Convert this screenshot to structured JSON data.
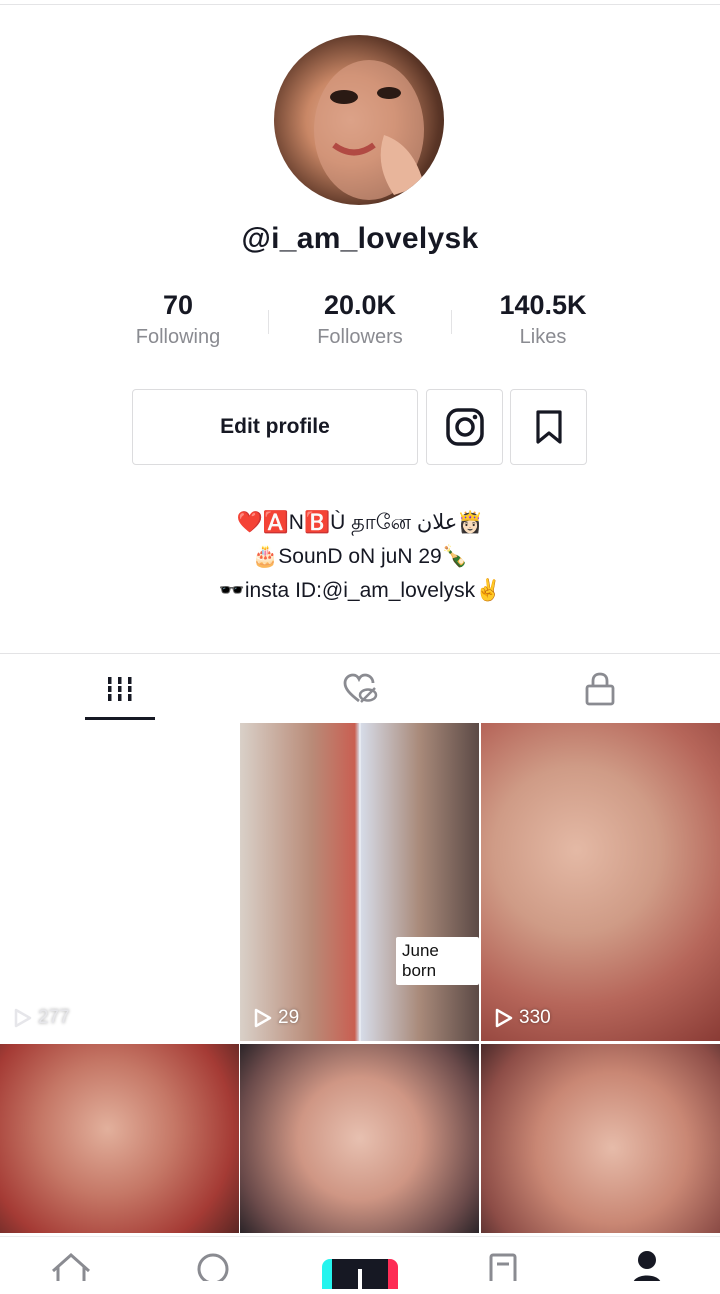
{
  "profile": {
    "username": "@i_am_lovelysk",
    "stats": [
      {
        "value": "70",
        "label": "Following"
      },
      {
        "value": "20.0K",
        "label": "Followers"
      },
      {
        "value": "140.5K",
        "label": "Likes"
      }
    ],
    "edit_label": "Edit profile",
    "bio": [
      "❤️🅰️N🅱️Ù தானே علان👸🏻",
      "🎂SounD oN juN 29🍾",
      "🕶️insta ID:@i_am_lovelysk✌️"
    ]
  },
  "tabs": [
    {
      "icon": "grid-icon",
      "active": true
    },
    {
      "icon": "liked-hidden-icon",
      "active": false
    },
    {
      "icon": "lock-icon",
      "active": false
    }
  ],
  "videos": [
    {
      "views": "277"
    },
    {
      "views": "29",
      "caption": "June born"
    },
    {
      "views": "330"
    },
    {
      "views": ""
    },
    {
      "views": ""
    },
    {
      "views": ""
    }
  ],
  "nav": [
    "home-icon",
    "discover-icon",
    "create-icon",
    "inbox-icon",
    "me-icon"
  ],
  "colors": {
    "accent_cyan": "#25f4ee",
    "accent_red": "#fe2c55",
    "text": "#161823",
    "muted": "#8a8b91"
  }
}
